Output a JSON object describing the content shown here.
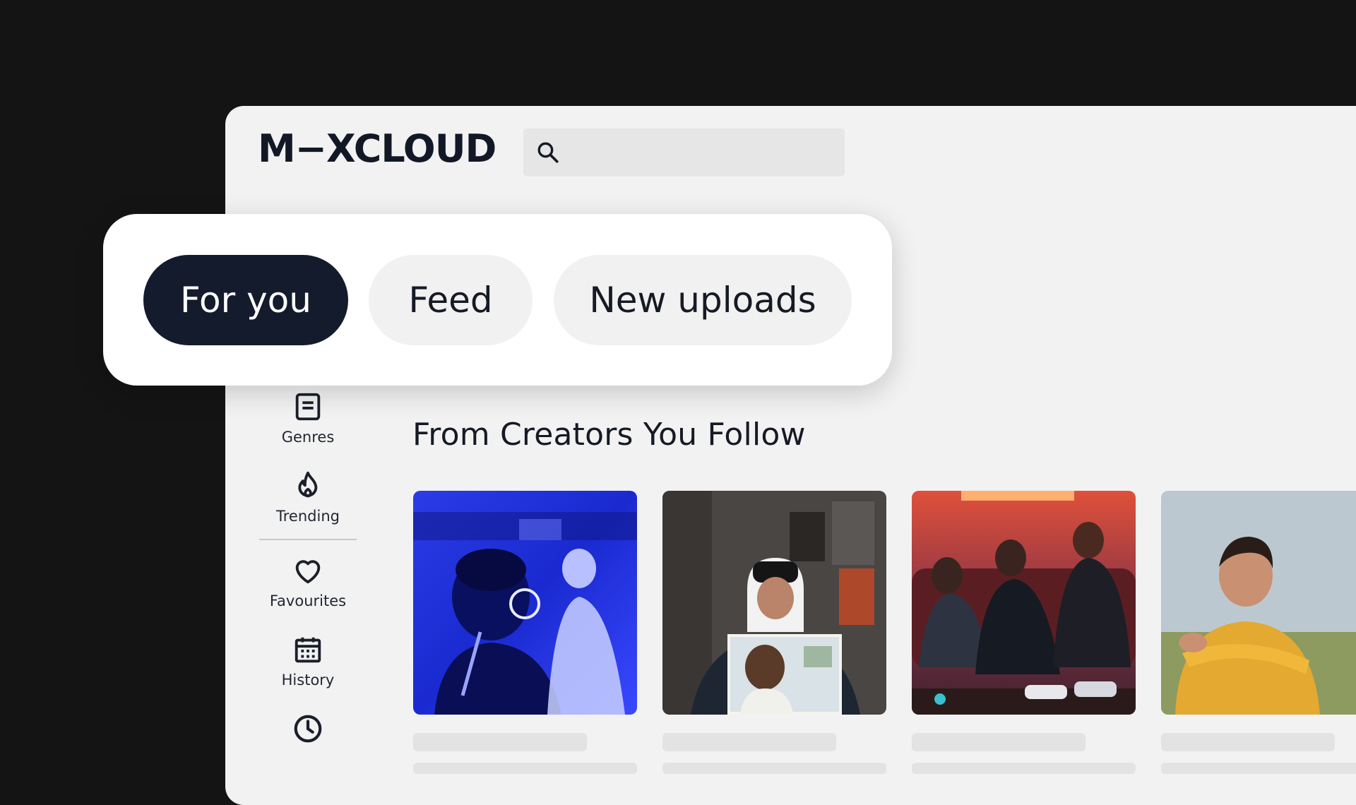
{
  "app": {
    "logo_text": "M−XCLOUD"
  },
  "search": {
    "placeholder": ""
  },
  "tabs": [
    {
      "label": "For you",
      "active": true
    },
    {
      "label": "Feed",
      "active": false
    },
    {
      "label": "New uploads",
      "active": false
    }
  ],
  "sidebar": {
    "items": [
      {
        "label": "Genres",
        "icon": "genres-icon"
      },
      {
        "label": "Trending",
        "icon": "flame-icon"
      },
      {
        "label": "Favourites",
        "icon": "heart-icon"
      },
      {
        "label": "History",
        "icon": "calendar-icon"
      },
      {
        "label": "",
        "icon": "clock-icon"
      }
    ]
  },
  "main": {
    "section_title": "From Creators You Follow",
    "cards": [
      {
        "image": "performer-blue-stage-photo"
      },
      {
        "image": "person-holding-photo"
      },
      {
        "image": "group-neon-sofa-photo"
      },
      {
        "image": "woman-yellow-sweater-photo"
      }
    ]
  },
  "colors": {
    "page_background": "#141414",
    "app_background": "#f2f2f2",
    "active_tab": "#141b2c",
    "tab": "#f1f1f1",
    "text": "#161a24"
  }
}
